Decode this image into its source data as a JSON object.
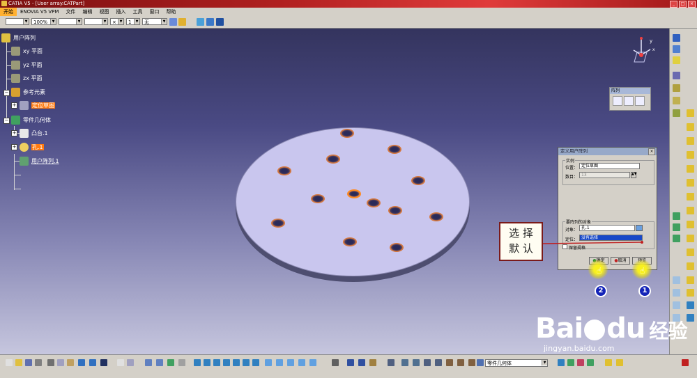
{
  "window": {
    "title": "CATIA V5 - [User array.CATPart]",
    "buttons": [
      "_",
      "□",
      "×"
    ]
  },
  "menubar": {
    "items": [
      "开始",
      "ENOVIA V5 VPM",
      "文件",
      "编辑",
      "视图",
      "插入",
      "工具",
      "窗口",
      "帮助"
    ]
  },
  "toolbar_top": {
    "zoom_value": "100%",
    "marker_value": "×",
    "layer_value": "无",
    "thickness_value": "1"
  },
  "tree": {
    "root": "用户阵列",
    "items": [
      "xy 平面",
      "yz 平面",
      "zx 平面",
      "参考元素",
      "定位草图",
      "零件几何体",
      "凸台.1",
      "孔.1",
      "用户阵列.1"
    ]
  },
  "array_toolbar": {
    "title": "阵列"
  },
  "dialog": {
    "title": "定义用户阵列",
    "instances_group": "实例",
    "position_label": "位置：",
    "position_value": "定位草图",
    "count_label": "数目：",
    "count_value": "13",
    "object_group": "要阵列的对象",
    "object_label": "对象：",
    "object_value": "孔.1",
    "anchor_label": "定位：",
    "anchor_value": "没有选择",
    "keep_spec_label": "保留规格",
    "ok_label": "确定",
    "cancel_label": "取消",
    "preview_label": "预览"
  },
  "callout": {
    "line1": "选 择",
    "line2": "默 认"
  },
  "steps": {
    "ok": "2",
    "preview": "1"
  },
  "bottom_toolbar": {
    "body_select_value": "零件几何体"
  },
  "watermark": {
    "brand": "Bai",
    "brand2": "du",
    "cn": "经验",
    "url": "jingyan.baidu.com"
  },
  "colors": {
    "highlight": "#ff7a10",
    "dialog_title": "#97a9c9",
    "callout_border": "#7a1a1a",
    "step_badge": "#1424b8"
  }
}
